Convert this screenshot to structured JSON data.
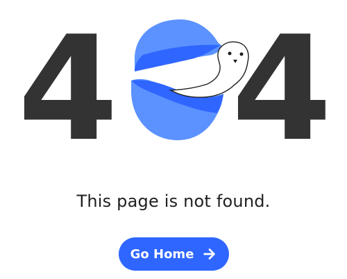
{
  "error_graphic": {
    "code": "404",
    "digit_left": "4",
    "digit_right": "4",
    "globe_icon": "blue-globe-icon",
    "ghost_icon": "ghost-icon",
    "colors": {
      "digit": "#333333",
      "globe_light": "#5b92ff",
      "globe_dark": "#2f66ff",
      "ghost_fill": "#ffffff",
      "ghost_outline": "#1f1f1f"
    }
  },
  "message": "This page is not found.",
  "home_button": {
    "label": "Go Home",
    "icon": "arrow-right-icon",
    "background_color": "#2f66ff",
    "text_color": "#ffffff"
  }
}
